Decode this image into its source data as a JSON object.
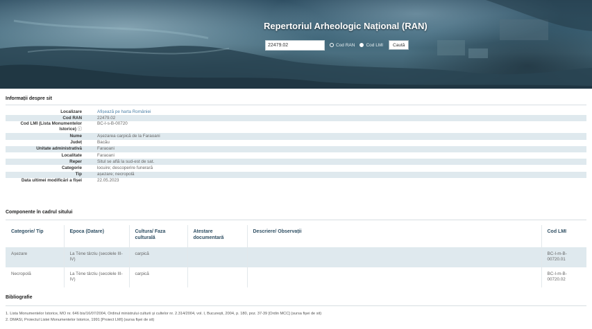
{
  "header": {
    "title": "Repertoriul Arheologic Național (RAN)",
    "search_value": "22479.02",
    "radio_ran_label": "Cod RAN",
    "radio_lmi_label": "Cod LMI",
    "search_button": "Caută",
    "selected_option": "Cod LMI"
  },
  "site_info": {
    "section_title": "Informații despre sit",
    "rows": [
      {
        "label": "Localizare",
        "value": "Afișează pe harta României",
        "link": true
      },
      {
        "label": "Cod RAN",
        "value": "22479.02"
      },
      {
        "label": "Cod LMI (Lista Monumentelor Istorice)",
        "value": "BC-I-s-B-00720"
      },
      {
        "label": "Nume",
        "value": "Așezarea carpică de la Faraoani"
      },
      {
        "label": "Județ",
        "value": "Bacău"
      },
      {
        "label": "Unitate administrativă",
        "value": "Faraoani"
      },
      {
        "label": "Localitate",
        "value": "Faraoani"
      },
      {
        "label": "Reper",
        "value": "Situl se află la sud-est de sat."
      },
      {
        "label": "Categorie",
        "value": "locuire; descoperire funerară"
      },
      {
        "label": "Tip",
        "value": "așezare; necropolă"
      },
      {
        "label": "Data ultimei modificări a fișei",
        "value": "22.05.2023"
      }
    ]
  },
  "components": {
    "section_title": "Componente în cadrul sitului",
    "headers": [
      "Categorie/ Tip",
      "Epoca (Datare)",
      "Cultura/ Faza culturală",
      "Atestare documentară",
      "Descriere/ Observații",
      "Cod LMI"
    ],
    "rows": [
      [
        "Așezare",
        "La Tène târziu (secolele III-IV)",
        "carpică",
        "",
        "",
        "BC-I-m-B-00720.01"
      ],
      [
        "Necropolă",
        "La Tène târziu (secolele III-IV)",
        "carpică",
        "",
        "",
        "BC-I-m-B-00720.02"
      ]
    ]
  },
  "bibliography": {
    "section_title": "Bibliografie",
    "items": [
      "1. Lista Monumentelor Istorice, MO nr. 646 bis/16/07/2004, Ordinul ministrului culturii și cultelor nr. 2.314/2004, vol. I, București, 2004, p. 180, poz. 37-39 [Ordin MCC] (sursa fișei de sit)",
      "2. DMASI, Proiectul Listei Monumentelor Istorice, 1991 [Proiect LMI] (sursa fișei de sit)"
    ]
  },
  "colors": {
    "header_bg": "#3d6478",
    "row_alt": "#dfe9ee",
    "link": "#4a7fa6",
    "table_header_text": "#2f4f63"
  }
}
